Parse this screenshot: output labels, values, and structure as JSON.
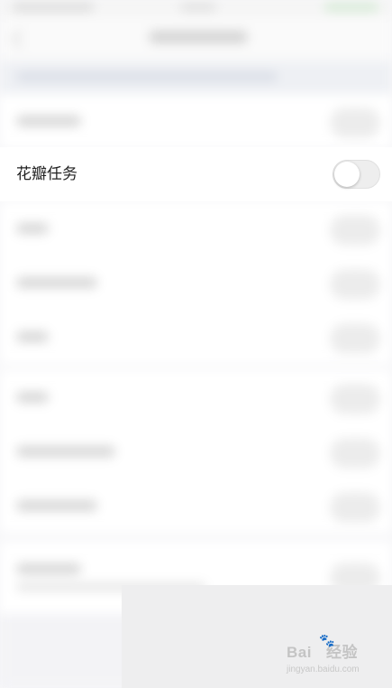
{
  "settings": {
    "row_label": "花瓣任务",
    "toggle_on": false
  },
  "watermark": {
    "brand": "Bai",
    "brand_suffix": "经验",
    "url": "jingyan.baidu.com"
  },
  "colors": {
    "toggle_off": "#eeeeee",
    "label_text": "#222222"
  }
}
